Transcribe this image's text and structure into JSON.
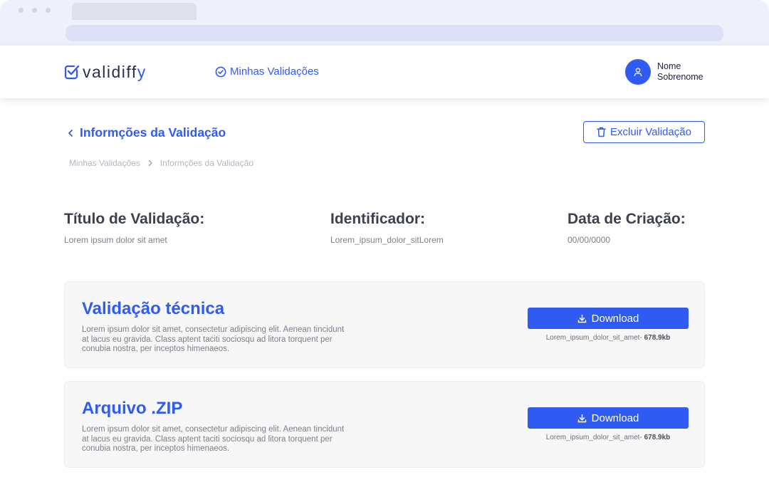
{
  "app": {
    "logo_text": "validiff",
    "logo_tail": "y",
    "nav_link": "Minhas Validações",
    "user_first": "Nome",
    "user_last": "Sobrenome"
  },
  "colors": {
    "accent": "#2f5bf2",
    "text_dark": "#3d4050",
    "muted": "#7c7f8a",
    "card_bg": "#f7f7f7"
  },
  "page": {
    "back_title": "Informções da Validação",
    "delete_label": "Excluir Validação",
    "breadcrumb": [
      "Minhas Validações",
      "Informções da Validação"
    ]
  },
  "info": {
    "title_label": "Título de Validação:",
    "title_value": "Lorem ipsum dolor sit amet",
    "id_label": "Identificador:",
    "id_value": "Lorem_ipsum_dolor_sitLorem",
    "date_label": "Data de Criação:",
    "date_value": "00/00/0000"
  },
  "cards": [
    {
      "title": "Validação técnica",
      "description": "Lorem ipsum dolor sit amet, consectetur adipiscing elit. Aenean tincidunt at lacus eu gravida. Class aptent taciti sociosqu ad litora torquent per conubia nostra, per inceptos himenaeos.",
      "button": "Download",
      "file_name": "Lorem_ipsum_dolor_sit_amet-",
      "file_size": "678.9kb"
    },
    {
      "title": "Arquivo .ZIP",
      "description": "Lorem ipsum dolor sit amet, consectetur adipiscing elit. Aenean tincidunt at lacus eu gravida. Class aptent taciti sociosqu ad litora torquent per conubia nostra, per inceptos himenaeos.",
      "button": "Download",
      "file_name": "Lorem_ipsum_dolor_sit_amet-",
      "file_size": "678.9kb"
    }
  ],
  "icons": [
    "logo-check-icon",
    "check-circle-icon",
    "user-icon",
    "chevron-left-icon",
    "trash-icon",
    "chevron-right-icon",
    "download-icon"
  ]
}
